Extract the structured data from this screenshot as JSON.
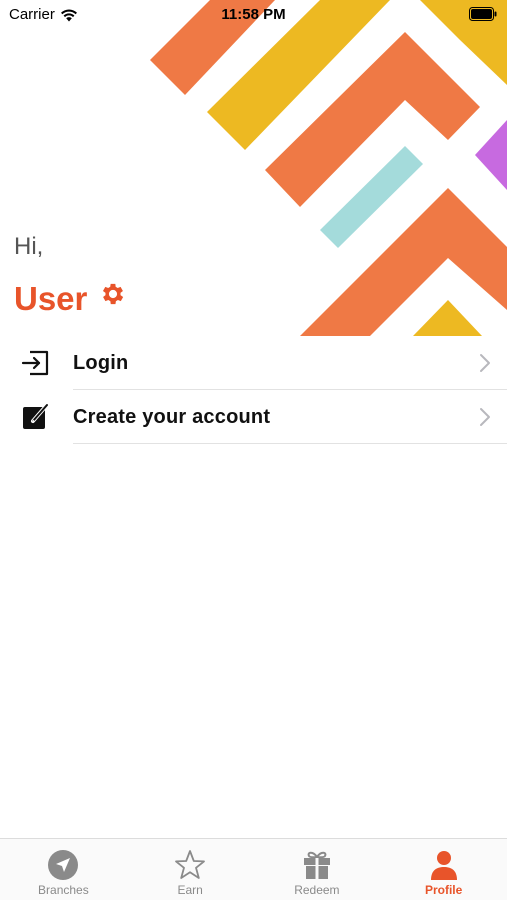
{
  "status_bar": {
    "carrier": "Carrier",
    "time": "11:58 PM"
  },
  "greeting": {
    "hi": "Hi,",
    "user": "User"
  },
  "menu": {
    "items": [
      {
        "label": "Login",
        "icon": "login-icon"
      },
      {
        "label": "Create your account",
        "icon": "edit-icon"
      }
    ]
  },
  "tab_bar": {
    "tabs": [
      {
        "label": "Branches",
        "icon": "navigation-arrow-icon"
      },
      {
        "label": "Earn",
        "icon": "star-icon"
      },
      {
        "label": "Redeem",
        "icon": "gift-icon"
      },
      {
        "label": "Profile",
        "icon": "person-icon",
        "active": true
      }
    ]
  },
  "colors": {
    "accent": "#e8542a",
    "orange": "#ef7945",
    "yellow": "#edb922",
    "teal": "#a4dbdb",
    "purple": "#c76ae0",
    "inactive_tab": "#8a8a8a"
  }
}
